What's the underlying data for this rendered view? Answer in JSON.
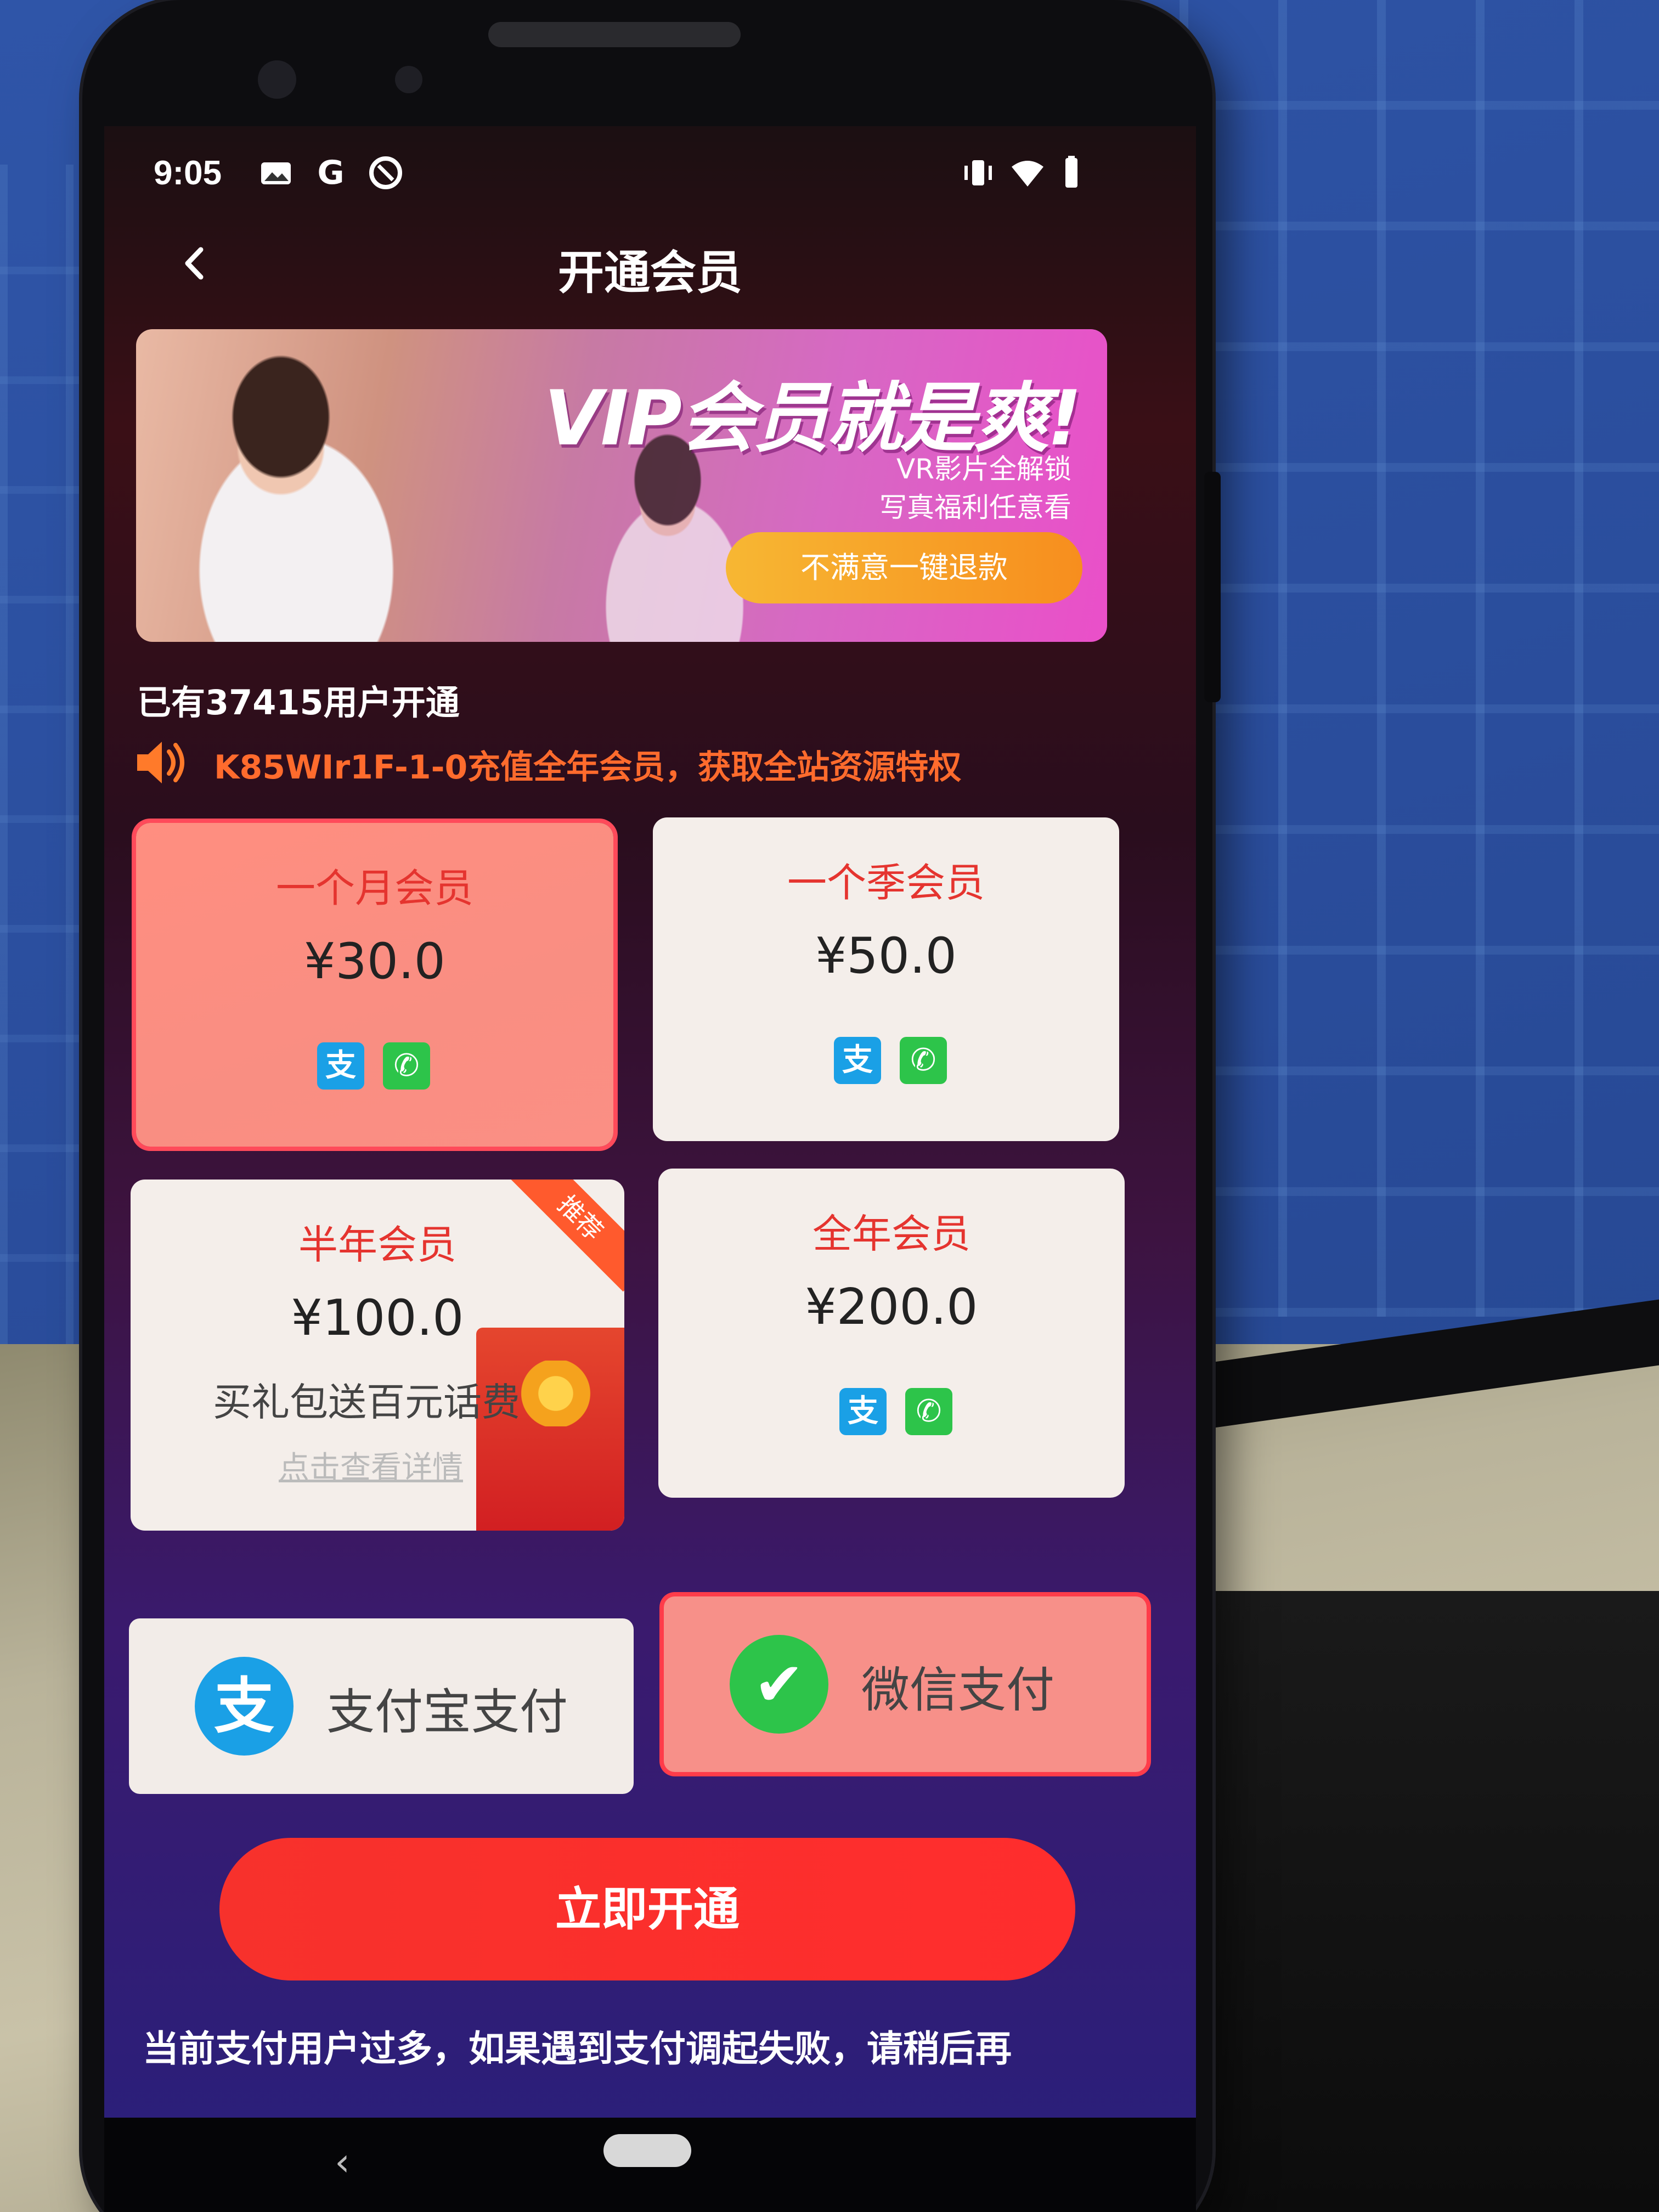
{
  "status_bar": {
    "time": "9:05",
    "icons": [
      "gallery-icon",
      "google-icon",
      "data-saver-icon",
      "vibrate-icon",
      "wifi-icon",
      "battery-icon"
    ],
    "icon_glyphs": {
      "google": "G"
    }
  },
  "header": {
    "title": "开通会员",
    "back_icon": "chevron-left-icon"
  },
  "banner": {
    "headline": "VIP会员就是爽!",
    "sub1": "VR影片全解锁",
    "sub2": "写真福利任意看",
    "refund_label": "不满意一键退款"
  },
  "stats": {
    "user_count_text": "已有37415用户开通"
  },
  "marquee": {
    "text": "K85WIr1F-1-0充值全年会员，获取全站资源特权",
    "icon": "speaker-icon",
    "color": "#ff6b2d"
  },
  "plans": [
    {
      "title": "一个月会员",
      "price": "¥30.0",
      "selected": true
    },
    {
      "title": "一个季会员",
      "price": "¥50.0",
      "selected": false
    },
    {
      "title": "半年会员",
      "price": "¥100.0",
      "promo": "买礼包送百元话费",
      "promo_link": "点击查看详情",
      "badge": "推荐",
      "selected": false
    },
    {
      "title": "全年会员",
      "price": "¥200.0",
      "selected": false
    }
  ],
  "pay_methods": [
    {
      "label": "支付宝支付",
      "icon": "alipay-icon",
      "glyph": "支",
      "selected": false
    },
    {
      "label": "微信支付",
      "icon": "wechat-icon",
      "glyph": "✔",
      "selected": true
    }
  ],
  "mini_pay_glyphs": {
    "alipay": "支",
    "wechat": "✆"
  },
  "submit_label": "立即开通",
  "notice": "当前支付用户过多，如果遇到支付调起失败，请稍后再",
  "system_nav": {
    "back_glyph": "‹"
  },
  "colors": {
    "accent_red": "#ff2d2d",
    "title_red": "#e5342f",
    "selected_card": "#f98e82",
    "alipay_blue": "#1aa0e6",
    "wechat_green": "#2dc44a",
    "refund_orange": "#f78e1e"
  }
}
